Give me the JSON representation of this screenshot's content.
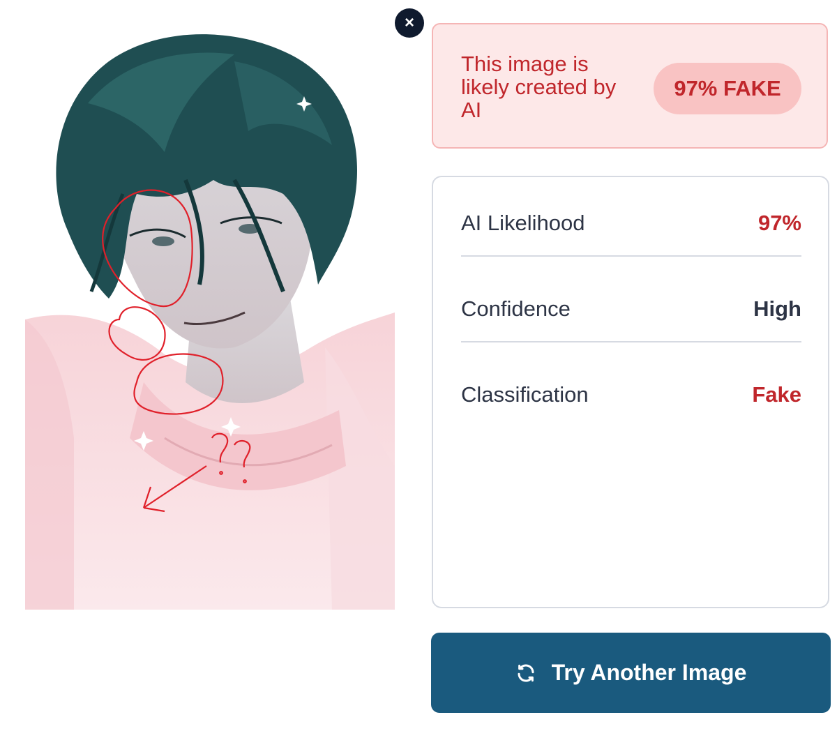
{
  "close_button": {
    "icon": "close-icon",
    "glyph": "×"
  },
  "verdict": {
    "message": "This image is likely created by AI",
    "badge": "97% FAKE",
    "color": "#c0262b",
    "background": "#fde8e8"
  },
  "stats": [
    {
      "label": "AI Likelihood",
      "value": "97%",
      "value_color": "#c0262b"
    },
    {
      "label": "Confidence",
      "value": "High",
      "value_color": "#2d3445"
    },
    {
      "label": "Classification",
      "value": "Fake",
      "value_color": "#c0262b"
    }
  ],
  "try_button": {
    "label": "Try Another Image",
    "icon": "refresh-icon",
    "color": "#1a5a7e"
  }
}
